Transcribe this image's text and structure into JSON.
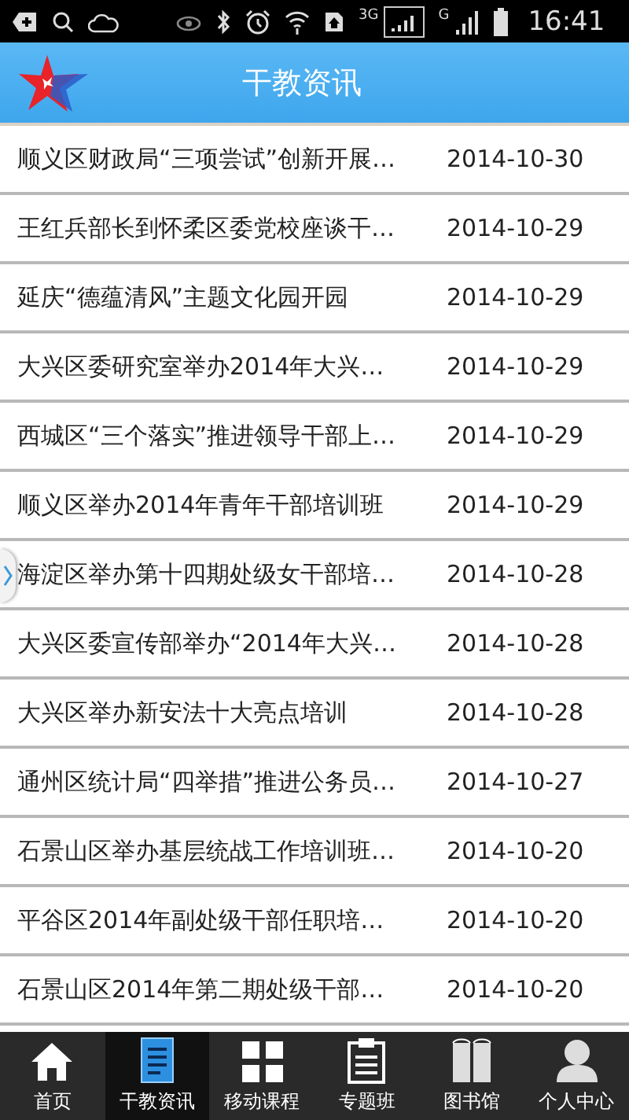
{
  "status_bar": {
    "network_3g": "3G",
    "network_g": "G",
    "time": "16:41"
  },
  "header": {
    "title": "干教资讯"
  },
  "news": [
    {
      "title": "顺义区财政局“三项尝试”创新开展…",
      "date": "2014-10-30"
    },
    {
      "title": "王红兵部长到怀柔区委党校座谈干…",
      "date": "2014-10-29"
    },
    {
      "title": "延庆“德蕴清风”主题文化园开园",
      "date": "2014-10-29"
    },
    {
      "title": "大兴区委研究室举办2014年大兴…",
      "date": "2014-10-29"
    },
    {
      "title": "西城区“三个落实”推进领导干部上…",
      "date": "2014-10-29"
    },
    {
      "title": "顺义区举办2014年青年干部培训班",
      "date": "2014-10-29"
    },
    {
      "title": "海淀区举办第十四期处级女干部培…",
      "date": "2014-10-28"
    },
    {
      "title": "大兴区委宣传部举办“2014年大兴…",
      "date": "2014-10-28"
    },
    {
      "title": "大兴区举办新安法十大亮点培训",
      "date": "2014-10-28"
    },
    {
      "title": "通州区统计局“四举措”推进公务员…",
      "date": "2014-10-27"
    },
    {
      "title": "石景山区举办基层统战工作培训班…",
      "date": "2014-10-20"
    },
    {
      "title": "平谷区2014年副处级干部任职培…",
      "date": "2014-10-20"
    },
    {
      "title": "石景山区2014年第二期处级干部…",
      "date": "2014-10-20"
    }
  ],
  "nav": [
    {
      "label": "首页",
      "kind": "home",
      "selected": false
    },
    {
      "label": "干教资讯",
      "kind": "news",
      "selected": true
    },
    {
      "label": "移动课程",
      "kind": "grid",
      "selected": false
    },
    {
      "label": "专题班",
      "kind": "clipboard",
      "selected": false
    },
    {
      "label": "图书馆",
      "kind": "books",
      "selected": false
    },
    {
      "label": "个人中心",
      "kind": "person",
      "selected": false
    }
  ]
}
